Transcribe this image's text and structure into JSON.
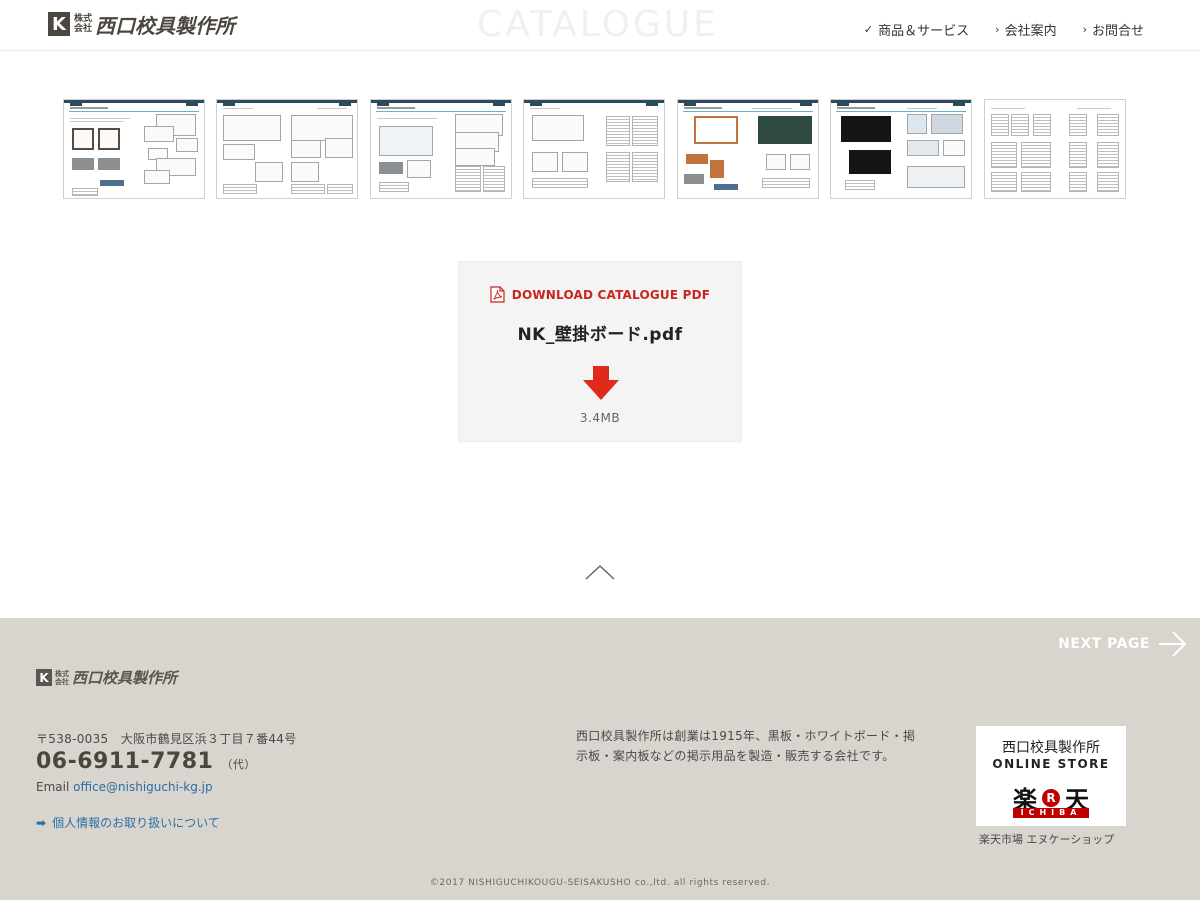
{
  "header": {
    "logo": {
      "mark": "K",
      "corp_line1": "株式",
      "corp_line2": "会社",
      "name": "西口校具製作所"
    },
    "page_title": "CATALOGUE",
    "nav": [
      {
        "mark": "✓",
        "label": "商品＆サービス"
      },
      {
        "mark": "›",
        "label": "会社案内"
      },
      {
        "mark": "›",
        "label": "お問合せ"
      }
    ]
  },
  "thumbnails": [
    {
      "page": 1
    },
    {
      "page": 2
    },
    {
      "page": 3
    },
    {
      "page": 4
    },
    {
      "page": 5
    },
    {
      "page": 6
    },
    {
      "page": 7
    }
  ],
  "download": {
    "label": "DOWNLOAD CATALOGUE PDF",
    "filename": "NK_壁掛ボード.pdf",
    "size": "3.4MB",
    "icon": "download-arrow-icon",
    "accent": "#c8251d"
  },
  "back_to_top": {
    "icon": "chevron-up-icon"
  },
  "footer": {
    "next_page": "NEXT PAGE",
    "logo": {
      "mark": "K",
      "corp_line1": "株式",
      "corp_line2": "会社",
      "name": "西口校具製作所"
    },
    "address": "〒538-0035　大阪市鶴見区浜３丁目７番44号",
    "phone": "06-6911-7781",
    "phone_note": "（代）",
    "email_label": "Email",
    "email": "office@nishiguchi-kg.jp",
    "privacy_link": "個人情報のお取り扱いについて",
    "description": "西口校具製作所は創業は1915年、黒板・ホワイトボード・掲示板・案内板などの掲示用品を製造・販売する会社です。",
    "store": {
      "name": "西口校具製作所",
      "sub": "ONLINE STORE",
      "rakuten_left": "楽",
      "rakuten_circle": "R",
      "rakuten_right": "天",
      "rakuten_bar": "ICHIBA",
      "caption": "楽天市場 エヌケーショップ"
    },
    "copyright": "©2017 NISHIGUCHIKOUGU-SEISAKUSHO co.,ltd. all rights reserved.",
    "background": "#d8d4ce"
  }
}
